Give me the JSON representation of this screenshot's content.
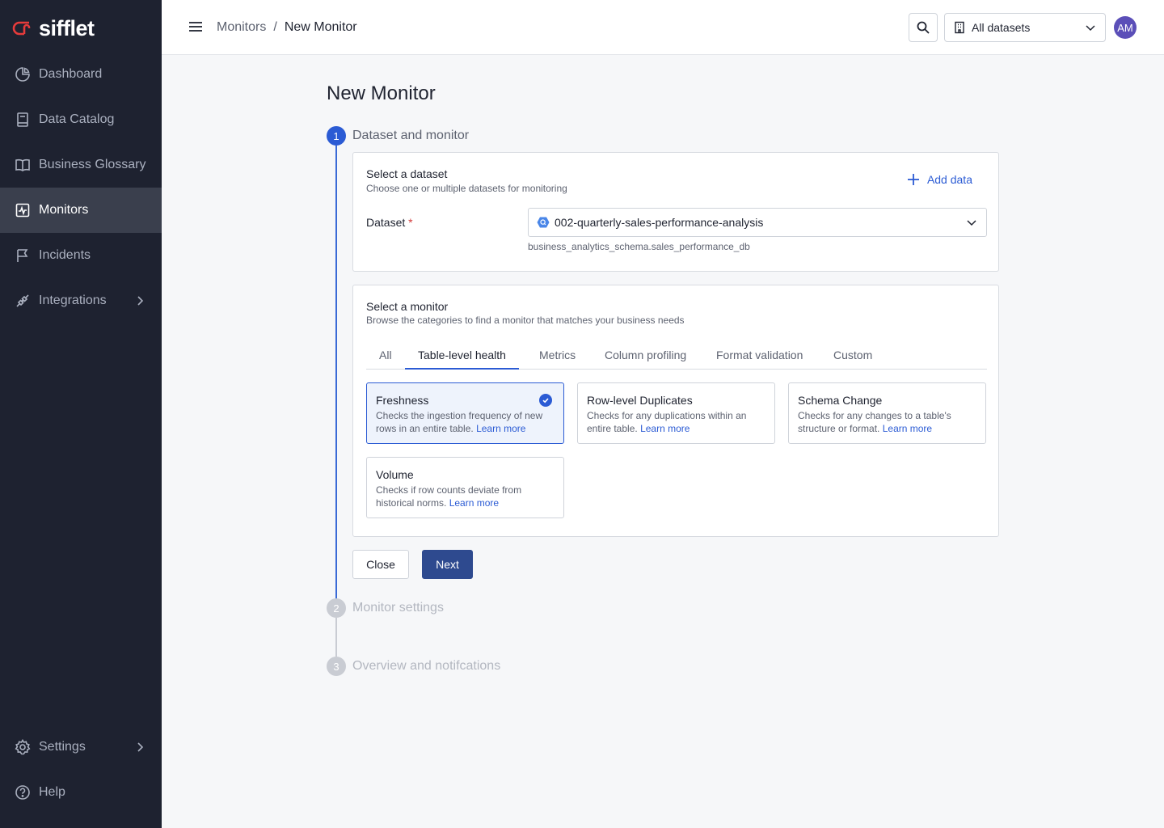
{
  "brand": {
    "name": "sifflet",
    "accent": "#e63b3b"
  },
  "sidebar": {
    "items": [
      {
        "label": "Dashboard",
        "icon": "dashboard-icon"
      },
      {
        "label": "Data Catalog",
        "icon": "book-icon"
      },
      {
        "label": "Business Glossary",
        "icon": "glossary-icon"
      },
      {
        "label": "Monitors",
        "icon": "monitor-icon",
        "active": true
      },
      {
        "label": "Incidents",
        "icon": "flag-icon"
      },
      {
        "label": "Integrations",
        "icon": "plug-icon"
      }
    ],
    "bottom": [
      {
        "label": "Settings",
        "icon": "gear-icon"
      },
      {
        "label": "Help",
        "icon": "help-icon"
      }
    ]
  },
  "header": {
    "breadcrumb": {
      "parent": "Monitors",
      "separator": "/",
      "current": "New Monitor"
    },
    "dataset_filter": "All datasets",
    "avatar_initials": "AM"
  },
  "page": {
    "title": "New Monitor"
  },
  "steps": [
    {
      "number": "1",
      "label": "Dataset and monitor",
      "state": "active"
    },
    {
      "number": "2",
      "label": "Monitor settings",
      "state": "pending"
    },
    {
      "number": "3",
      "label": "Overview and notifcations",
      "state": "pending"
    }
  ],
  "dataset_card": {
    "title": "Select a dataset",
    "subtitle": "Choose one or multiple datasets for monitoring",
    "add_data_label": "Add data",
    "field_label": "Dataset",
    "required_mark": "*",
    "selected_dataset": "002-quarterly-sales-performance-analysis",
    "dataset_path": "business_analytics_schema.sales_performance_db"
  },
  "monitor_card": {
    "title": "Select a monitor",
    "subtitle": "Browse the categories to find a monitor that matches your business needs",
    "tabs": [
      {
        "label": "All"
      },
      {
        "label": "Table-level health",
        "active": true
      },
      {
        "label": "Metrics"
      },
      {
        "label": "Column profiling"
      },
      {
        "label": "Format validation"
      },
      {
        "label": "Custom"
      }
    ],
    "monitors": [
      {
        "title": "Freshness",
        "desc": "Checks the ingestion frequency of new rows in an entire table.",
        "link": "Learn more",
        "selected": true
      },
      {
        "title": "Row-level Duplicates",
        "desc": "Checks for any duplications within an entire table.",
        "link": "Learn more"
      },
      {
        "title": "Schema Change",
        "desc": "Checks for any changes to a table's structure or format.",
        "link": "Learn more"
      },
      {
        "title": "Volume",
        "desc": "Checks if row counts deviate from historical norms.",
        "link": "Learn more"
      }
    ]
  },
  "actions": {
    "close_label": "Close",
    "next_label": "Next"
  }
}
